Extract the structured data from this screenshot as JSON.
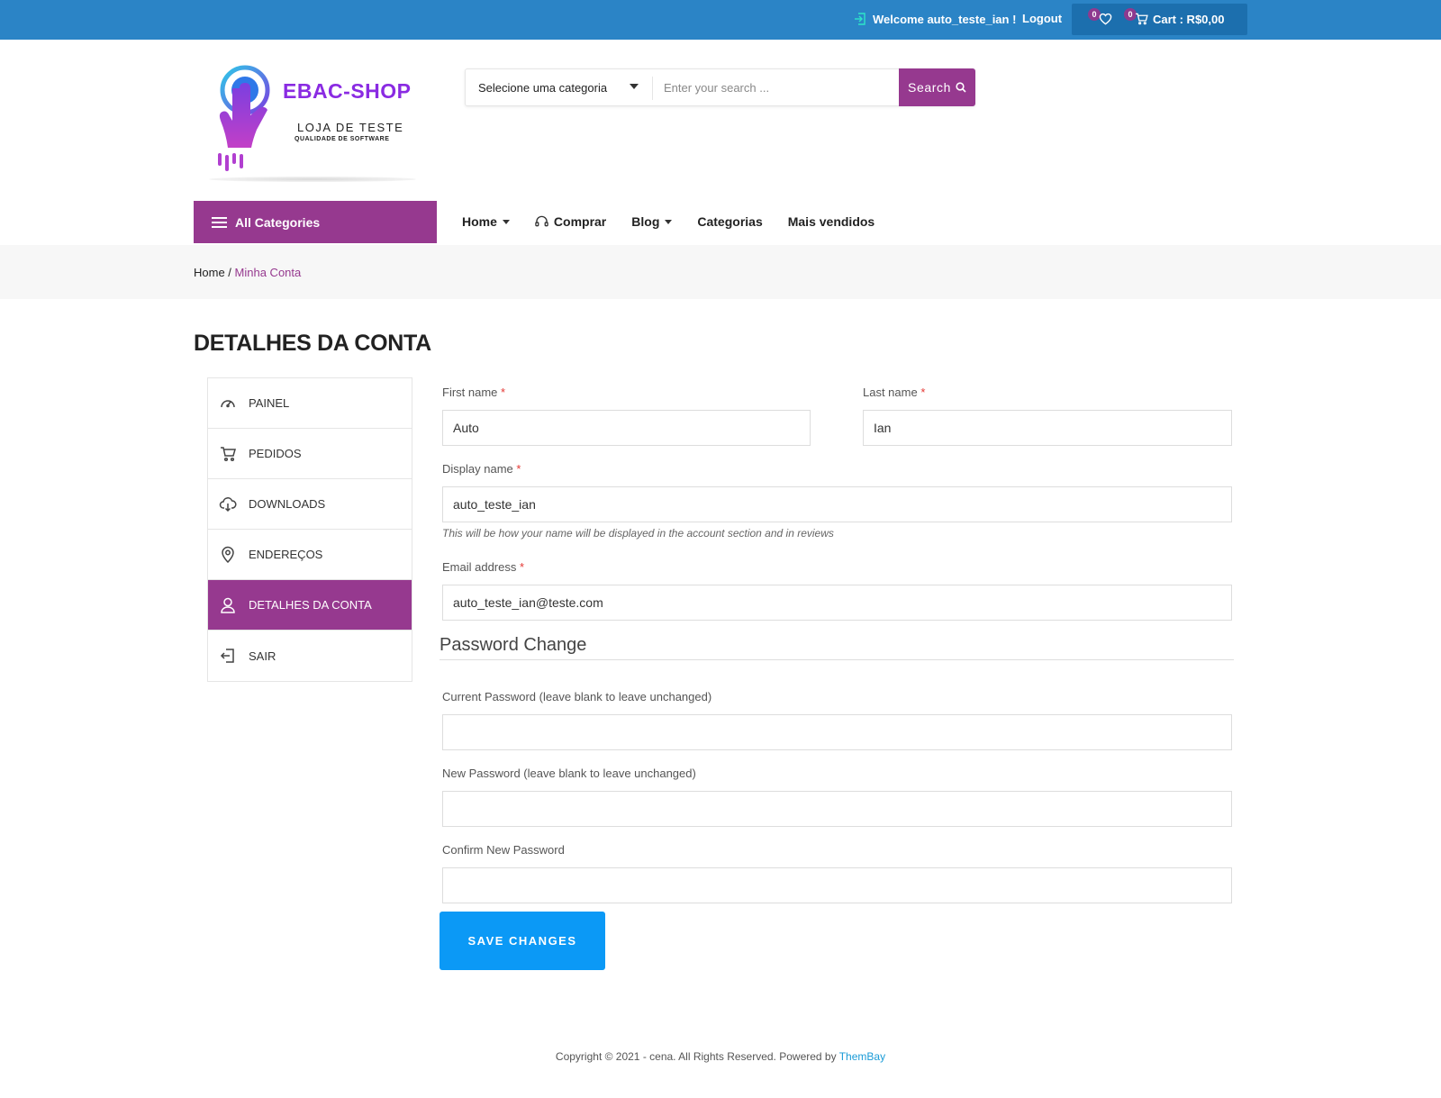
{
  "topbar": {
    "welcome": "Welcome auto_teste_ian !",
    "logout": "Logout",
    "wishlist_count": "0",
    "cart_count": "0",
    "cart_label": "Cart : R$0,00"
  },
  "logo": {
    "brand": "EBAC-SHOP",
    "line1": "LOJA DE TESTE",
    "line2": "QUALIDADE DE SOFTWARE"
  },
  "search": {
    "category": "Selecione uma categoria",
    "placeholder": "Enter your search ...",
    "button": "Search"
  },
  "nav": {
    "all_categories": "All Categories",
    "items": [
      "Home",
      "Comprar",
      "Blog",
      "Categorias",
      "Mais vendidos"
    ]
  },
  "breadcrumb": {
    "home": "Home",
    "separator": " / ",
    "current": "Minha Conta"
  },
  "page_title": "DETALHES DA CONTA",
  "sidemenu": [
    {
      "label": "PAINEL",
      "icon": "dashboard-icon"
    },
    {
      "label": "PEDIDOS",
      "icon": "cart-icon"
    },
    {
      "label": "DOWNLOADS",
      "icon": "cloud-download-icon"
    },
    {
      "label": "ENDEREÇOS",
      "icon": "location-pin-icon"
    },
    {
      "label": "DETALHES DA CONTA",
      "icon": "user-icon",
      "active": true
    },
    {
      "label": "SAIR",
      "icon": "logout-icon"
    }
  ],
  "form": {
    "first_name_label": "First name",
    "first_name_value": "Auto",
    "last_name_label": "Last name",
    "last_name_value": "Ian",
    "display_name_label": "Display name",
    "display_name_value": "auto_teste_ian",
    "display_name_hint": "This will be how your name will be displayed in the account section and in reviews",
    "email_label": "Email address",
    "email_value": "auto_teste_ian@teste.com",
    "required_mark": "*",
    "password_section_title": "Password Change",
    "current_password_label": "Current Password (leave blank to leave unchanged)",
    "new_password_label": "New Password (leave blank to leave unchanged)",
    "confirm_password_label": "Confirm New Password",
    "save_button": "SAVE CHANGES"
  },
  "footer": {
    "text": "Copyright © 2021 - cena. All Rights Reserved. Powered by ",
    "link": "ThemBay"
  },
  "colors": {
    "topbar": "#2b84c6",
    "accent": "#96398f",
    "save_button": "#0b99f6"
  }
}
